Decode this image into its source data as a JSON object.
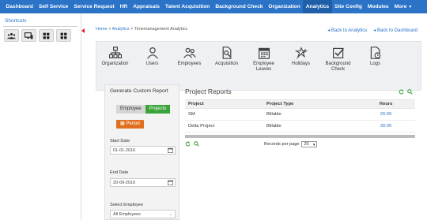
{
  "nav": {
    "items": [
      "Dashboard",
      "Self Service",
      "Service Request",
      "HR",
      "Appraisals",
      "Talent Acquisition",
      "Background Check",
      "Organization",
      "Analytics",
      "Site Config",
      "Modules",
      "More"
    ]
  },
  "shortcuts": {
    "title": "Shortcuts"
  },
  "breadcrumb": {
    "home": "Home",
    "sep1": " > ",
    "analytics": "Analytics",
    "sep2": " > ",
    "current": "Timemanagement Analytics"
  },
  "back": {
    "analytics": "Back to Analytics",
    "dashboard": "Back to Dashboard"
  },
  "strip": {
    "items": [
      {
        "label": "Organization",
        "icon": "organization-icon"
      },
      {
        "label": "Users",
        "icon": "users-icon"
      },
      {
        "label": "Employees",
        "icon": "employees-icon"
      },
      {
        "label": "Acquisition",
        "icon": "acquisition-icon"
      },
      {
        "label": "Employee Leaves",
        "icon": "calendar-icon"
      },
      {
        "label": "Holidays",
        "icon": "holidays-icon"
      },
      {
        "label": "Background Check",
        "icon": "checkbox-icon"
      },
      {
        "label": "Logs",
        "icon": "logs-icon"
      }
    ]
  },
  "report": {
    "title": "Generate Custom Report",
    "tab_employee": "Employee",
    "tab_projects": "Projects",
    "period": "Period",
    "start_label": "Start Date",
    "start_value": "01-01-2016",
    "end_label": "End Date",
    "end_value": "20-09-2016",
    "employee_label": "Select Employee",
    "employee_value": "All Employees"
  },
  "projects": {
    "title": "Project Reports",
    "headers": [
      "Project",
      "Project Type",
      "Hours"
    ],
    "rows": [
      [
        "SM",
        "Billable",
        "26:00"
      ],
      [
        "Delta Project",
        "Billable",
        "30:00"
      ]
    ],
    "records_label": "Records per page",
    "records_value": "20"
  },
  "colors": {
    "nav": "#2a73c7",
    "active_tab": "#3aa33a",
    "period": "#e07020",
    "link": "#2a73c7"
  }
}
